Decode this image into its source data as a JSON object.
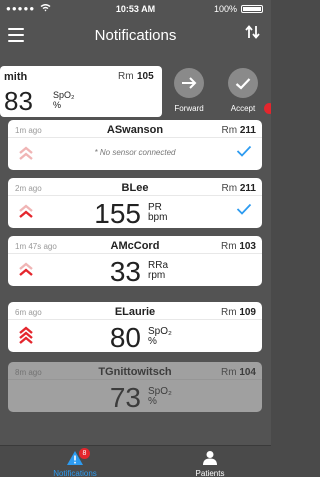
{
  "status_bar": {
    "signal": "●●●●●",
    "time": "10:53 AM",
    "battery": "100%"
  },
  "nav": {
    "title": "Notifications"
  },
  "swiped": {
    "name": "mith",
    "room_label": "Rm",
    "room": "105",
    "value": "83",
    "unit_top": "SpO₂",
    "unit_bottom": "%"
  },
  "actions": {
    "forward": "Forward",
    "accept": "Accept"
  },
  "alerts": [
    {
      "time": "1m ago",
      "name": "ASwanson",
      "room_label": "Rm",
      "room": "211",
      "sensor_text": "* No sensor connected",
      "severity": 1,
      "accepted": true
    },
    {
      "time": "2m ago",
      "name": "BLee",
      "room_label": "Rm",
      "room": "211",
      "value": "155",
      "unit_top": "PR",
      "unit_bottom": "bpm",
      "severity": 2,
      "accepted": true
    },
    {
      "time": "1m 47s ago",
      "name": "AMcCord",
      "room_label": "Rm",
      "room": "103",
      "value": "33",
      "unit_top": "RRa",
      "unit_bottom": "rpm",
      "severity": 2,
      "accepted": false
    },
    {
      "time": "6m ago",
      "name": "ELaurie",
      "room_label": "Rm",
      "room": "109",
      "value": "80",
      "unit_top": "SpO₂",
      "unit_bottom": "%",
      "severity": 3,
      "accepted": false
    },
    {
      "time": "8m ago",
      "name": "TGnittowitsch",
      "room_label": "Rm",
      "room": "104",
      "value": "73",
      "unit_top": "SpO₂",
      "unit_bottom": "%",
      "severity": 0,
      "accepted": false
    }
  ],
  "tabs": {
    "notifications_label": "Notifications",
    "notifications_badge": "8",
    "patients_label": "Patients"
  },
  "colors": {
    "accent": "#2d9bf0",
    "alarm": "#e4262d",
    "chevron_light": "#f0b5b5"
  }
}
